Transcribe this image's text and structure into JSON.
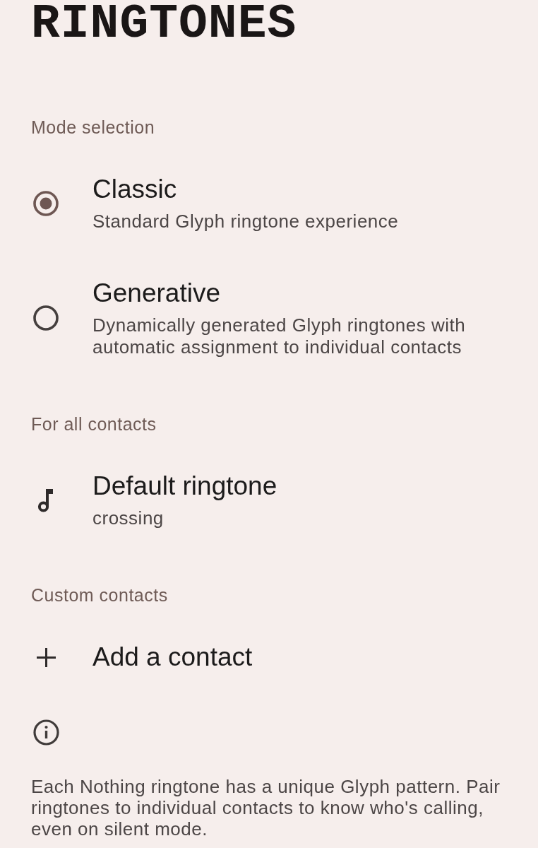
{
  "title": "RINGTONES",
  "sections": [
    {
      "header": "Mode selection",
      "items": [
        {
          "kind": "radio",
          "title": "Classic",
          "subtitle": "Standard Glyph ringtone experience",
          "selected": true
        },
        {
          "kind": "radio",
          "title": "Generative",
          "subtitle": "Dynamically generated Glyph ringtones with automatic assignment to individual contacts",
          "selected": false
        }
      ]
    },
    {
      "header": "For all contacts",
      "items": [
        {
          "kind": "ringtone",
          "title": "Default ringtone",
          "subtitle": "crossing"
        }
      ]
    },
    {
      "header": "Custom contacts",
      "items": [
        {
          "kind": "add",
          "title": "Add a contact"
        }
      ]
    }
  ],
  "footer": {
    "text": "Each Nothing ringtone has a unique Glyph pattern. Pair ringtones to individual contacts to know who's calling, even on silent mode."
  }
}
